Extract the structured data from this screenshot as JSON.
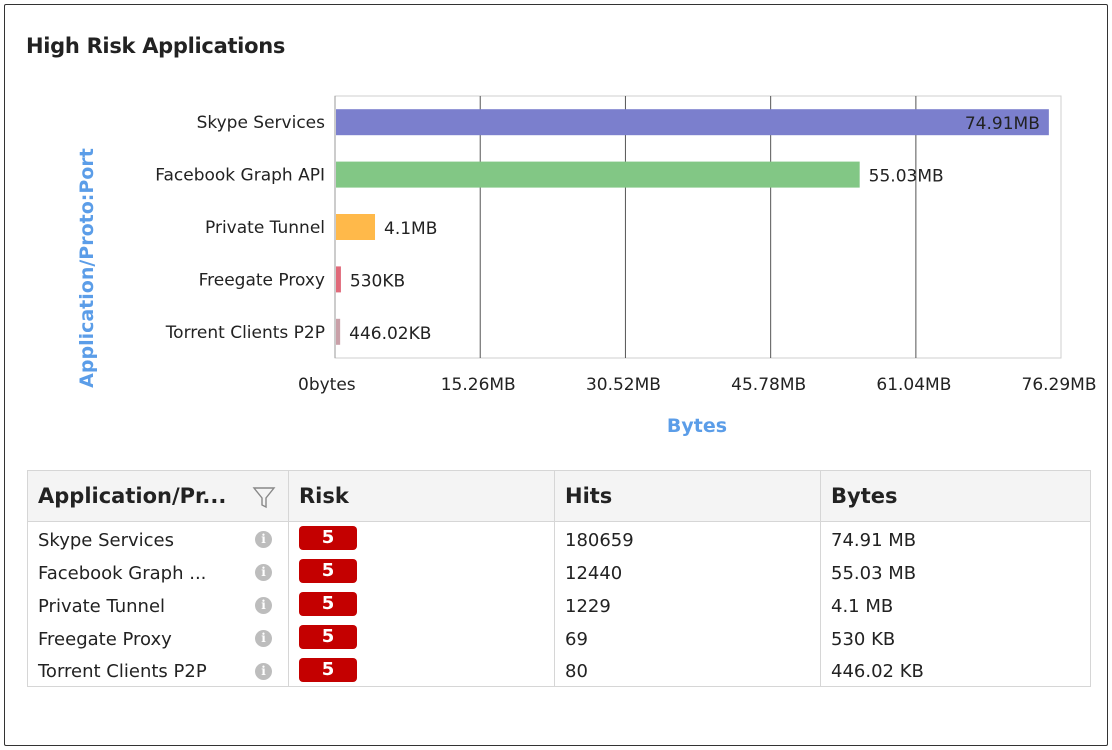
{
  "panel": {
    "title": "High Risk Applications"
  },
  "chart_data": {
    "type": "bar",
    "orientation": "horizontal",
    "title": "High Risk Applications",
    "xlabel": "Bytes",
    "ylabel": "Application/Proto:Port",
    "categories": [
      "Skype Services",
      "Facebook Graph API",
      "Private Tunnel",
      "Freegate Proxy",
      "Torrent Clients P2P"
    ],
    "values_mb": [
      74.91,
      55.03,
      4.1,
      0.5176,
      0.4356
    ],
    "value_labels": [
      "74.91MB",
      "55.03MB",
      "4.1MB",
      "530KB",
      "446.02KB"
    ],
    "colors": [
      "#7b7fcd",
      "#82c785",
      "#ffb94a",
      "#e06a7a",
      "#c9a0a8"
    ],
    "xlim_mb": [
      0,
      76.29
    ],
    "x_ticks_mb": [
      0,
      15.26,
      30.52,
      45.78,
      61.04,
      76.29
    ],
    "x_tick_labels": [
      "0bytes",
      "15.26MB",
      "30.52MB",
      "45.78MB",
      "61.04MB",
      "76.29MB"
    ],
    "grid": true,
    "legend": "none"
  },
  "table": {
    "headers": [
      "Application/Pr...",
      "Risk",
      "Hits",
      "Bytes"
    ],
    "rows": [
      {
        "app": "Skype Services",
        "risk": "5",
        "hits": "180659",
        "bytes": "74.91 MB"
      },
      {
        "app": "Facebook Graph ...",
        "risk": "5",
        "hits": "12440",
        "bytes": "55.03 MB"
      },
      {
        "app": "Private Tunnel",
        "risk": "5",
        "hits": "1229",
        "bytes": "4.1 MB"
      },
      {
        "app": "Freegate Proxy",
        "risk": "5",
        "hits": "69",
        "bytes": "530 KB"
      },
      {
        "app": "Torrent Clients P2P",
        "risk": "5",
        "hits": "80",
        "bytes": "446.02 KB"
      }
    ],
    "info_icon": "info-icon",
    "filter_icon": "filter-icon"
  }
}
